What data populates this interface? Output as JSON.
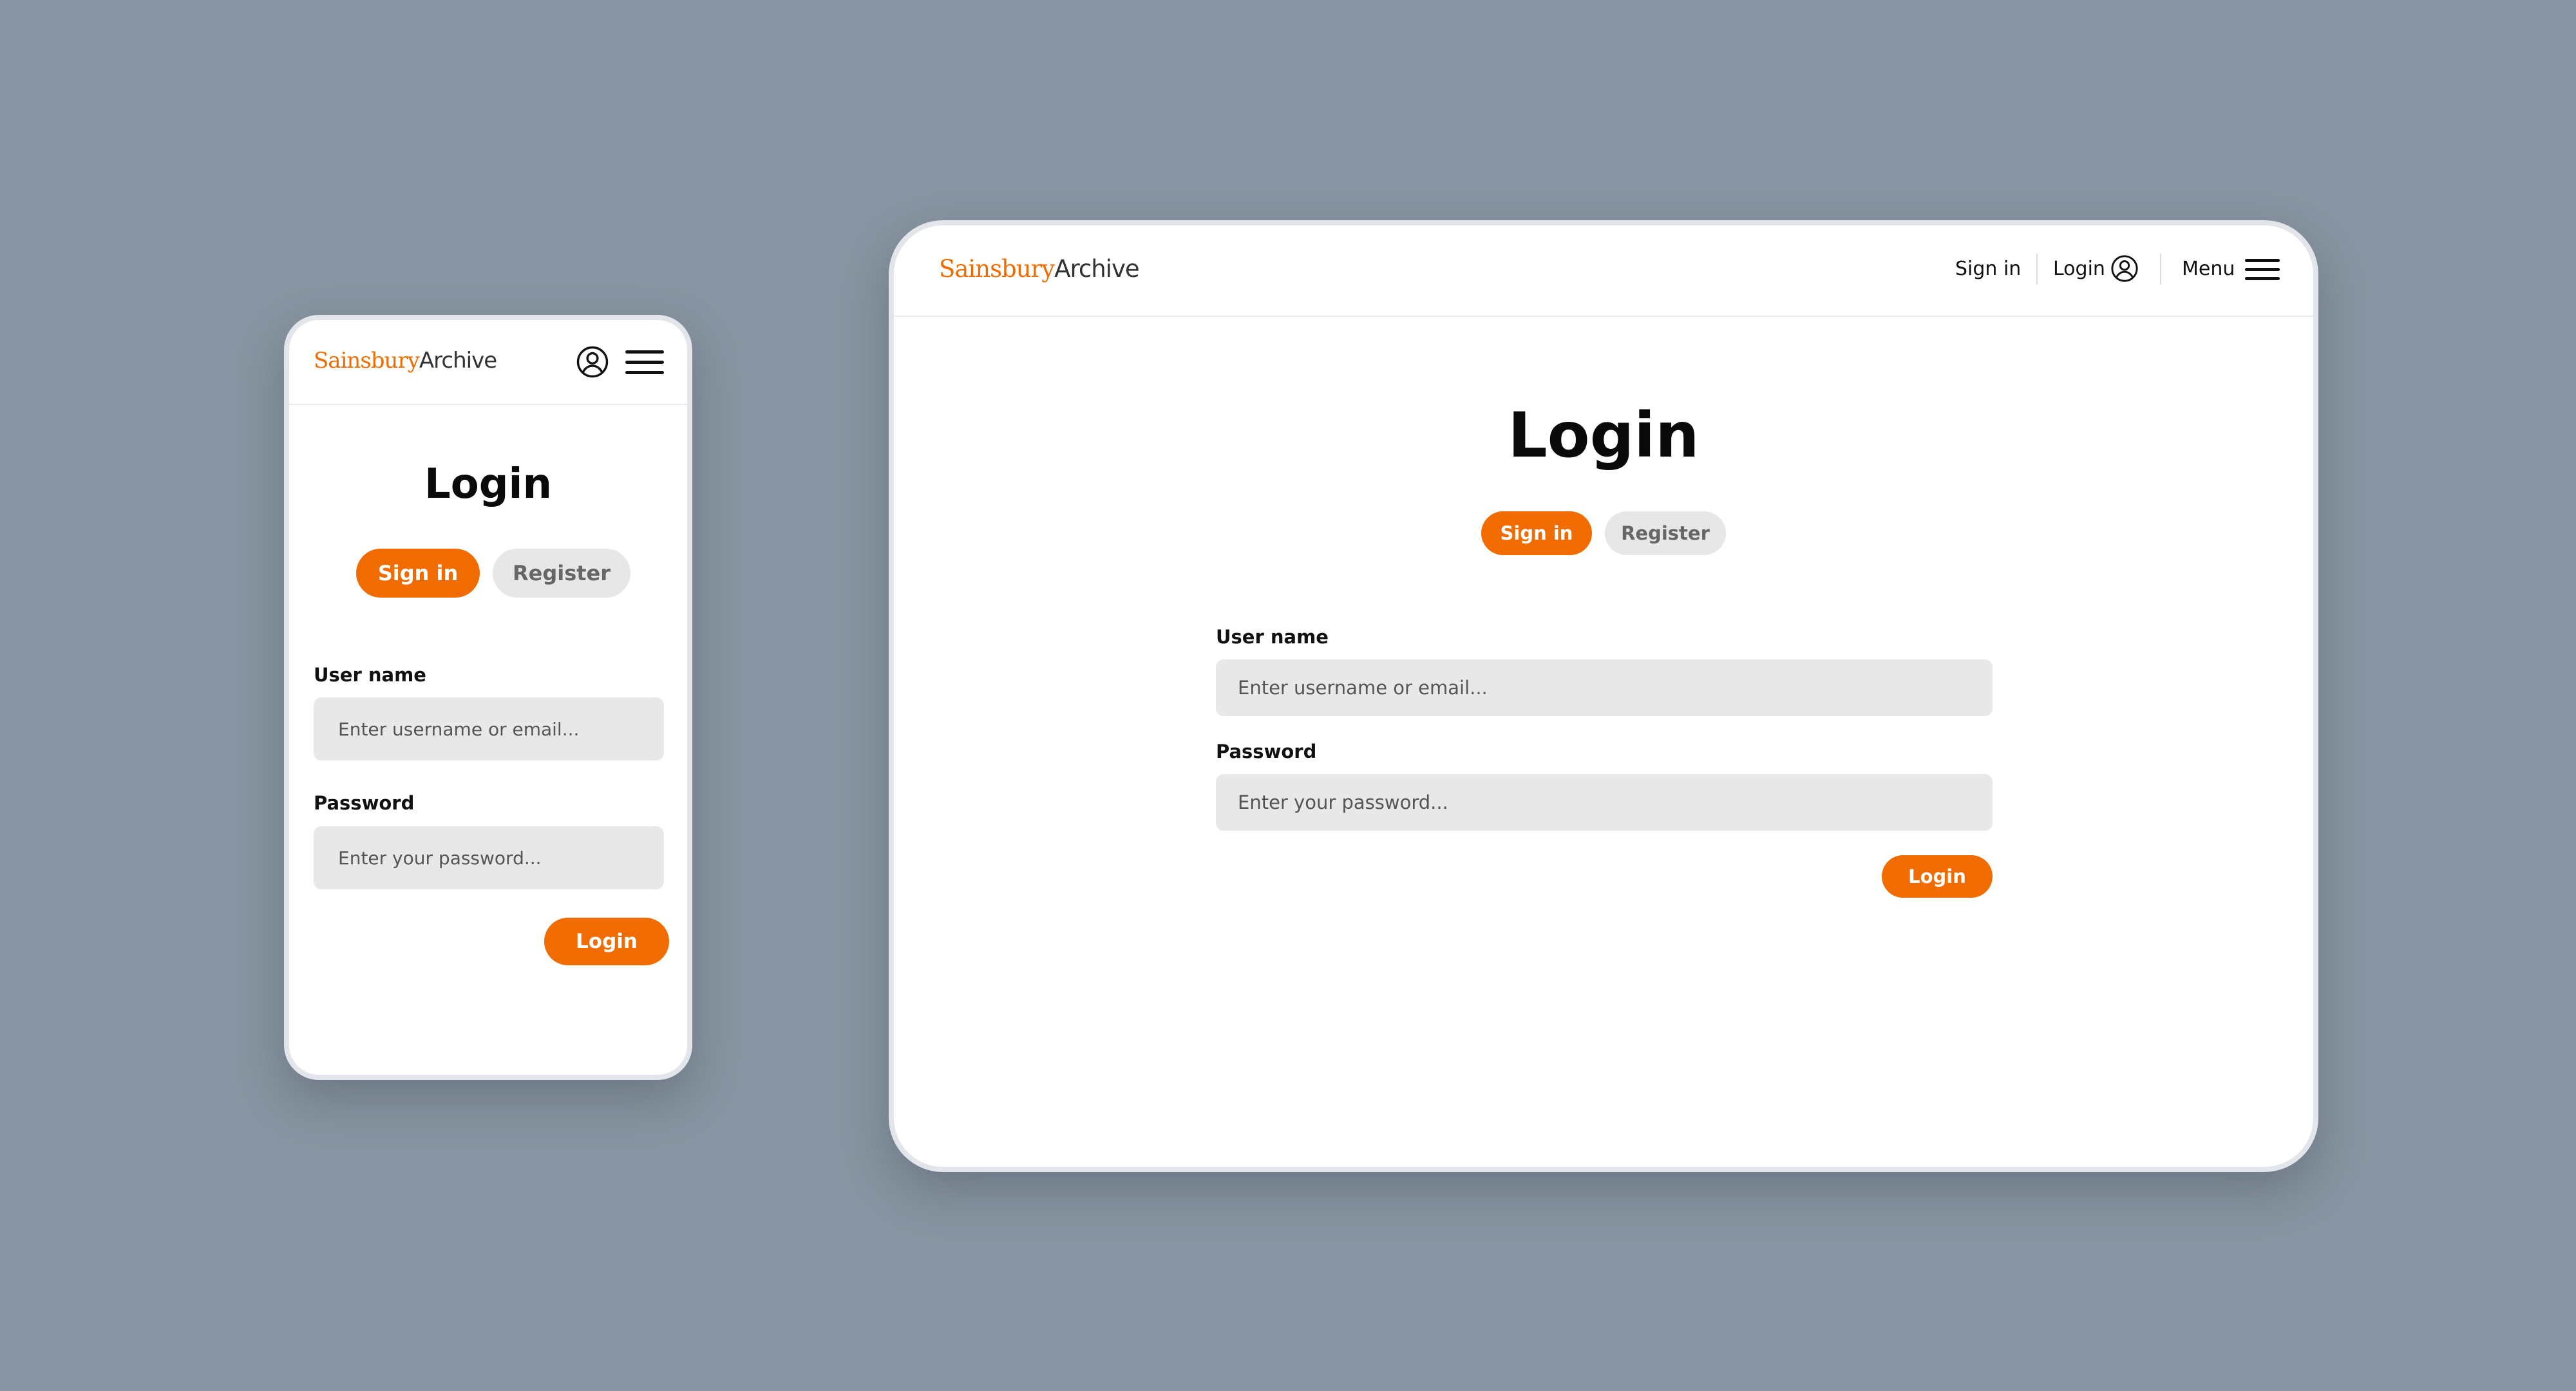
{
  "brand": {
    "part1": "Sainsbury",
    "part2": "Archive",
    "accent_color": "#f06c00"
  },
  "icons": {
    "account": "user-circle-icon",
    "menu": "hamburger-icon"
  },
  "nav": {
    "sign_in": "Sign in",
    "login": "Login",
    "menu": "Menu"
  },
  "page": {
    "title": "Login"
  },
  "tabs": {
    "sign_in": "Sign in",
    "register": "Register",
    "active": "Sign in"
  },
  "form": {
    "username_label": "User name",
    "username_placeholder": "Enter username or email...",
    "password_label": "Password",
    "password_placeholder": "Enter your password...",
    "submit_label": "Login"
  }
}
